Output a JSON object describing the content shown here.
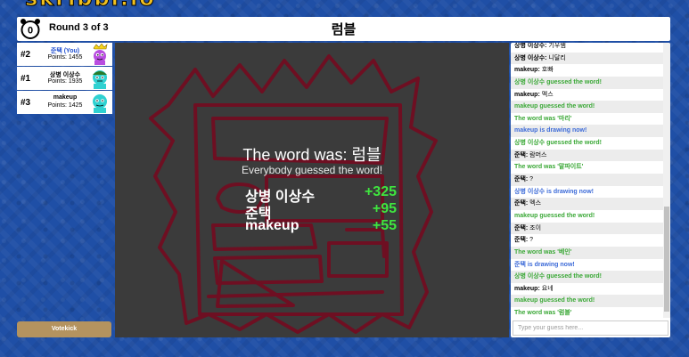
{
  "logo": {
    "text": "skribbl.io"
  },
  "header": {
    "timer": "0",
    "round": "Round 3 of 3",
    "word": "럼블"
  },
  "players": [
    {
      "rank": "#2",
      "name": "준택 (You)",
      "points": "Points: 1455"
    },
    {
      "rank": "#1",
      "name": "상병 이상수",
      "points": "Points: 1935"
    },
    {
      "rank": "#3",
      "name": "makeup",
      "points": "Points: 1425"
    }
  ],
  "votekick": "Votekick",
  "overlay": {
    "title": "The word was: 럼블",
    "subtitle": "Everybody guessed the word!",
    "scores": [
      {
        "name": "상병 이상수",
        "points": "+325"
      },
      {
        "name": "준택",
        "points": "+95"
      },
      {
        "name": "makeup",
        "points": "+55"
      }
    ]
  },
  "chat": {
    "messages": [
      {
        "type": "normal",
        "user": "상병 이상수:",
        "text": "기우쌤"
      },
      {
        "type": "normal",
        "user": "상병 이상수:",
        "text": "니달리"
      },
      {
        "type": "normal",
        "user": "makeup:",
        "text": "호빠"
      },
      {
        "type": "green",
        "text": "상병 이상수 guessed the word!"
      },
      {
        "type": "normal",
        "user": "makeup:",
        "text": "멕스"
      },
      {
        "type": "green",
        "text": "makeup guessed the word!"
      },
      {
        "type": "green",
        "text": "The word was '마리'"
      },
      {
        "type": "blue",
        "text": "makeup is drawing now!"
      },
      {
        "type": "green",
        "text": "상병 이상수 guessed the word!"
      },
      {
        "type": "normal",
        "user": "준택:",
        "text": "람머스"
      },
      {
        "type": "green",
        "text": "The word was '말파이트'"
      },
      {
        "type": "normal",
        "user": "준택:",
        "text": "?"
      },
      {
        "type": "blue",
        "text": "상병 이상수 is drawing now!"
      },
      {
        "type": "normal",
        "user": "준택:",
        "text": "멕스"
      },
      {
        "type": "green",
        "text": "makeup guessed the word!"
      },
      {
        "type": "normal",
        "user": "준택:",
        "text": "조이"
      },
      {
        "type": "normal",
        "user": "준택:",
        "text": "?"
      },
      {
        "type": "green",
        "text": "The word was '베인'"
      },
      {
        "type": "blue",
        "text": "준택 is drawing now!"
      },
      {
        "type": "green",
        "text": "상병 이상수 guessed the word!"
      },
      {
        "type": "normal",
        "user": "makeup:",
        "text": "요네"
      },
      {
        "type": "green",
        "text": "makeup guessed the word!"
      },
      {
        "type": "green",
        "text": "The word was '럼블'"
      }
    ],
    "input_placeholder": "Type your guess here..."
  },
  "colors": {
    "background": "#1f4fa6",
    "canvas": "#3b3b3b",
    "stroke": "#6e0f22",
    "guessed": "#3aa836",
    "drawing_notice": "#3d6bd8",
    "overlay_points": "#3fe53f"
  }
}
